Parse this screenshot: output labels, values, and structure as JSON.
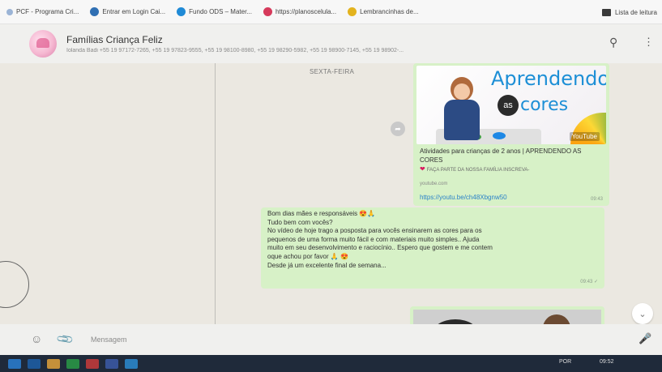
{
  "bookmarks": [
    {
      "label": "PCF - Programa Cri...",
      "color": "#9bb4d6"
    },
    {
      "label": "Entrar em Login Cai...",
      "color": "#2f6fb3"
    },
    {
      "label": "Fundo ODS – Mater...",
      "color": "#1f8ad6"
    },
    {
      "label": "https://planoscelula...",
      "color": "#d63a5b"
    },
    {
      "label": "Lembrancinhas de...",
      "color": "#e3b31e"
    }
  ],
  "reading_list": "Lista de leitura",
  "chat": {
    "group_name": "Famílias Criança Feliz",
    "members": "Iolanda Badi  +55 19 97172-7265, +55 19 97823-9555, +55 19 98100-8980, +55 19 98290-5982, +55 19 98900-7145, +55 19 98902-...",
    "search_icon": "search-icon",
    "menu_icon": "menu-dots-icon"
  },
  "messages": {
    "day_label": "SEXTA-FEIRA",
    "link_card": {
      "thumb_title_1": "Aprendendo",
      "thumb_as": "as",
      "thumb_title_2": "cores",
      "yt": "YouTube",
      "title": "Atividades para crianças de 2 anos | APRENDENDO AS CORES",
      "desc": "FAÇA PARTE DA NOSSA FAMÍLIA INSCREVA-",
      "domain": "youtube.com",
      "url": "https://youtu.be/ch48Xbgnw50",
      "time": "09:43"
    },
    "text_lines": [
      "Bom dias mães e responsáveis 😍🙏",
      "Tudo bem com vocês?",
      "No vídeo de hoje trago a posposta para vocês ensinarem as cores para os",
      "pequenos de uma forma muito fácil e com materiais muito simples.. Ajuda",
      "muito em seu desenvolvimento e raciocínio.. Espero que gostem e me contem",
      "oque achou por favor 🙏 😍",
      "Desde já um excelente final de semana..."
    ],
    "text_time": "09:43 ✓"
  },
  "composer": {
    "placeholder": "Mensagem"
  },
  "taskbar": {
    "lang": "POR",
    "time": "09:52"
  }
}
